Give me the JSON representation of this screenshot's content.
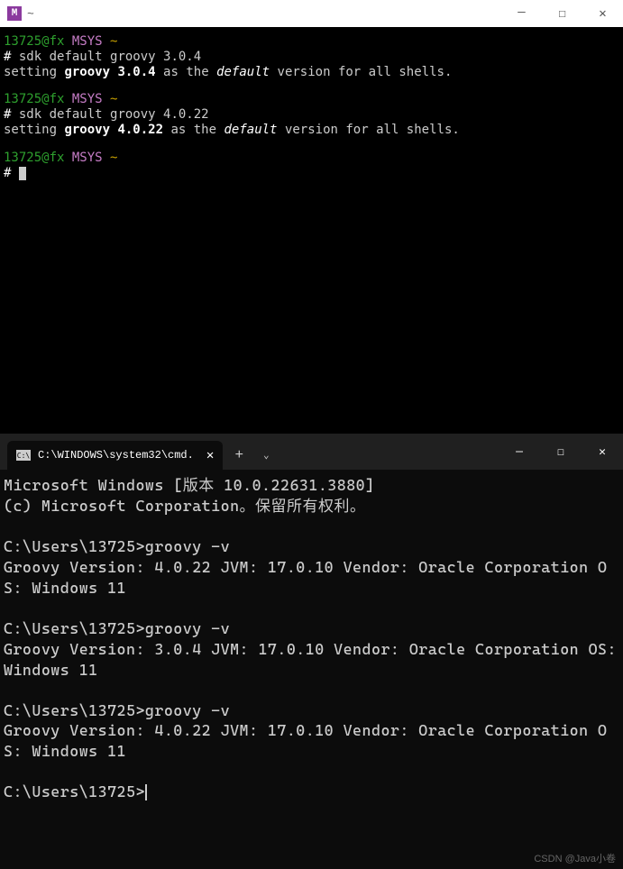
{
  "msys": {
    "icon_letter": "M",
    "title": "~",
    "prompt": {
      "user": "13725@fx",
      "host": "MSYS",
      "path": "~",
      "symbol": "#"
    },
    "block1": {
      "command": "sdk default groovy 3.0.4",
      "output_pre": "setting",
      "output_pkg": "groovy 3.0.4",
      "output_mid": "as the",
      "output_keyword": "default",
      "output_post": "version for all shells."
    },
    "block2": {
      "command": "sdk default groovy 4.0.22",
      "output_pre": "setting",
      "output_pkg": "groovy 4.0.22",
      "output_mid": "as the",
      "output_keyword": "default",
      "output_post": "version for all shells."
    }
  },
  "cmd": {
    "tab_title": "C:\\WINDOWS\\system32\\cmd.",
    "header1": "Microsoft Windows [版本 10.0.22631.3880]",
    "header2": "(c) Microsoft Corporation。保留所有权利。",
    "blocks": [
      {
        "prompt": "C:\\Users\\13725>",
        "command": "groovy -v",
        "output": "Groovy Version: 4.0.22 JVM: 17.0.10 Vendor: Oracle Corporation OS: Windows 11"
      },
      {
        "prompt": "C:\\Users\\13725>",
        "command": "groovy -v",
        "output": "Groovy Version: 3.0.4 JVM: 17.0.10 Vendor: Oracle Corporation OS: Windows 11"
      },
      {
        "prompt": "C:\\Users\\13725>",
        "command": "groovy -v",
        "output": "Groovy Version: 4.0.22 JVM: 17.0.10 Vendor: Oracle Corporation OS: Windows 11"
      }
    ],
    "final_prompt": "C:\\Users\\13725>"
  },
  "watermark": "CSDN @Java小卷"
}
